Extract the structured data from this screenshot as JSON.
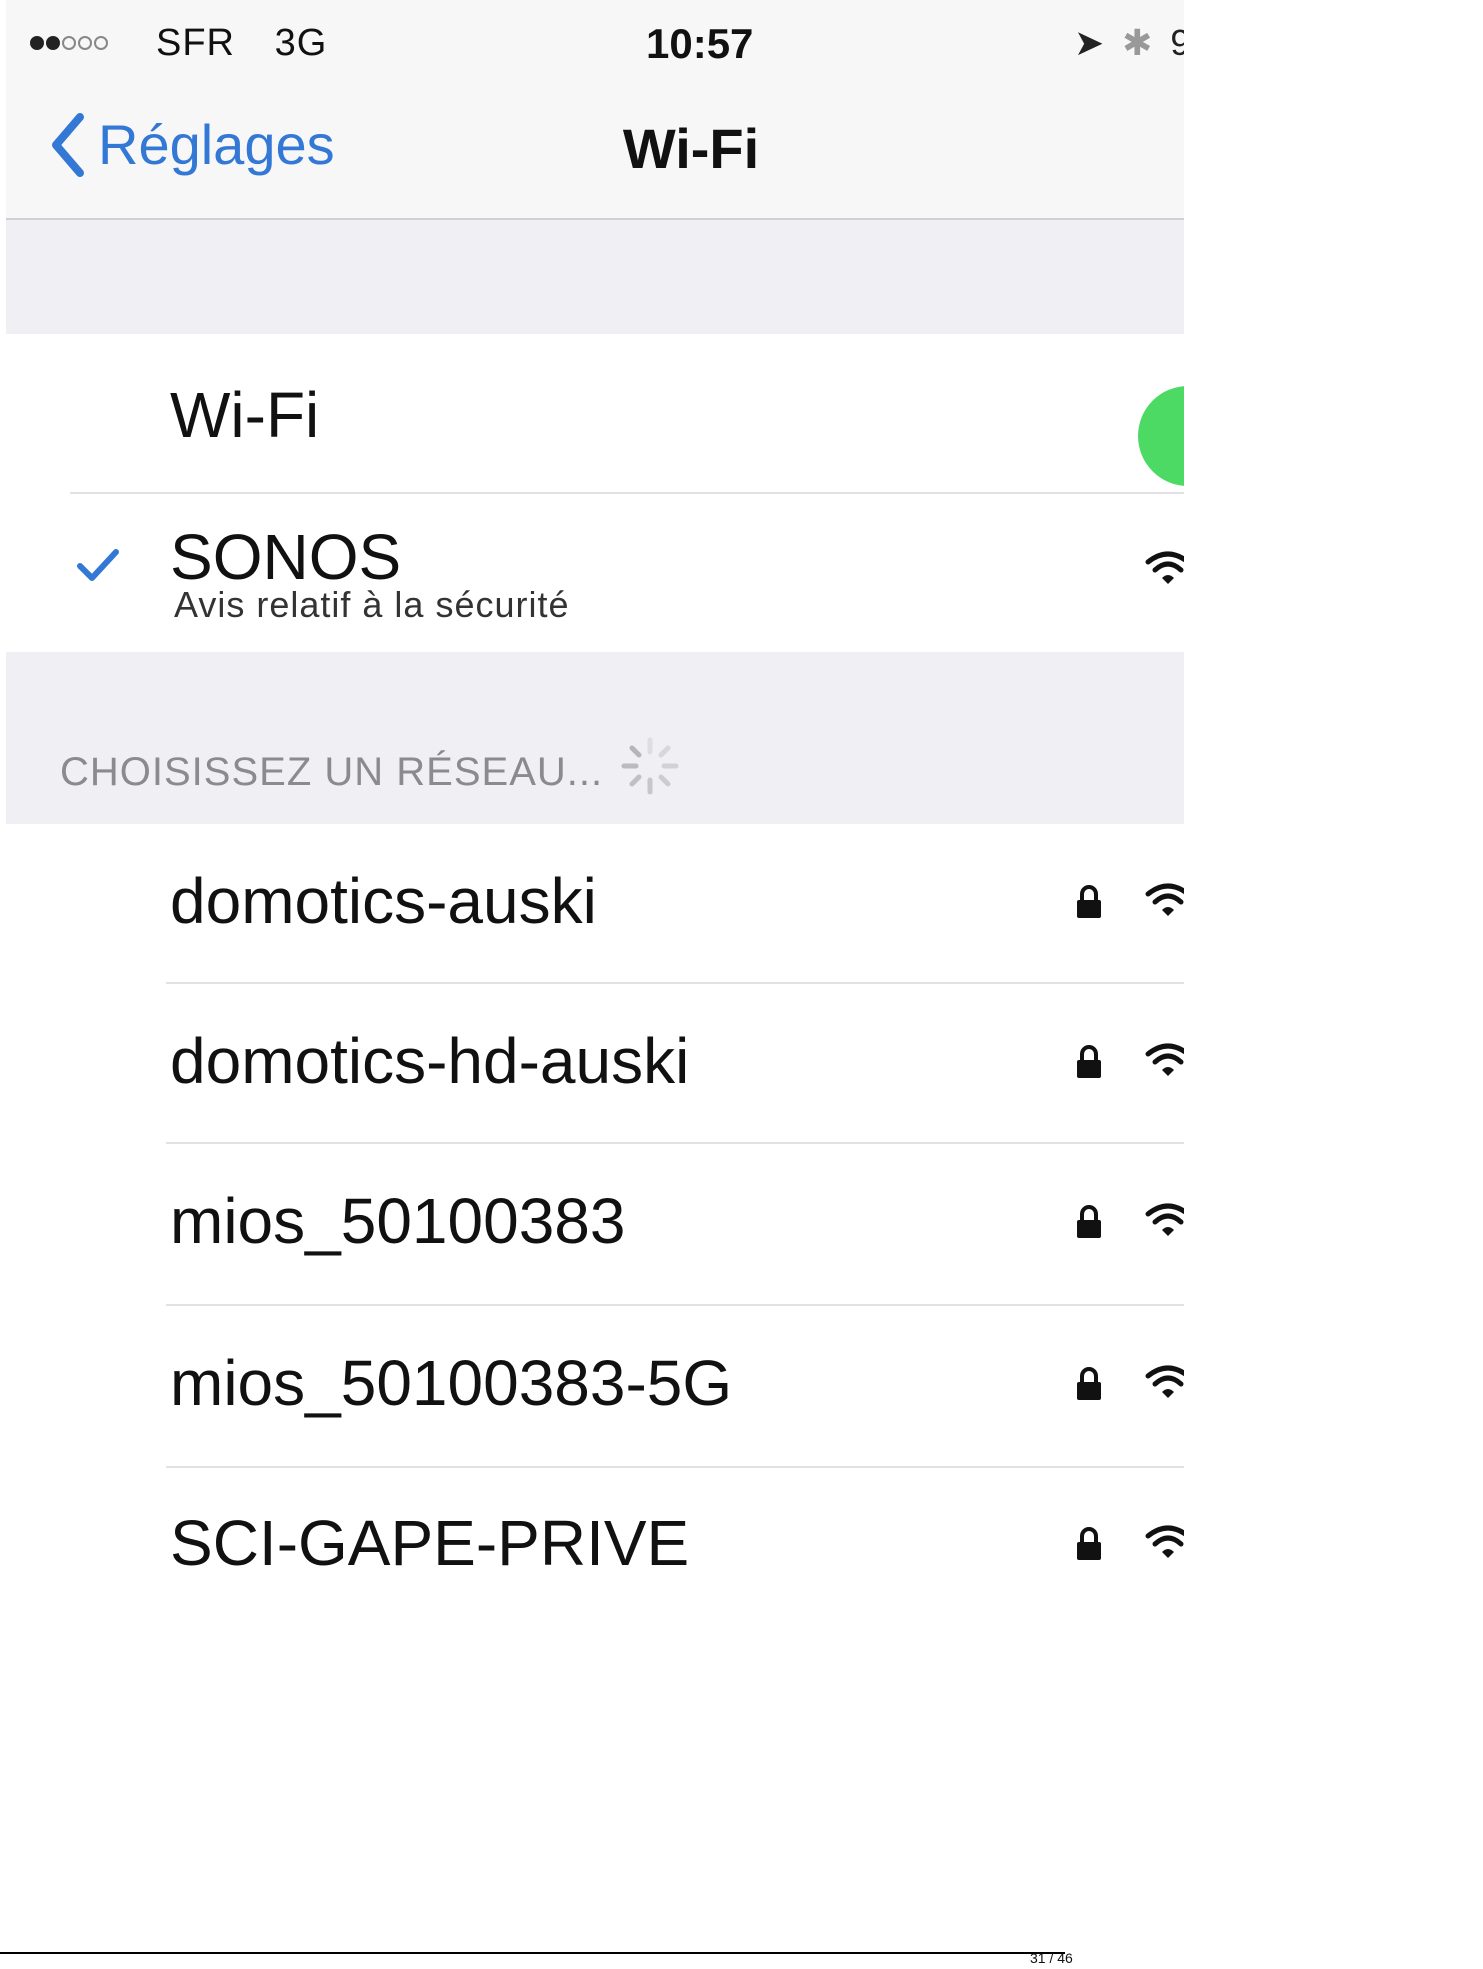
{
  "status_bar": {
    "carrier": "SFR",
    "network": "3G",
    "time": "10:57",
    "signal_bars_filled": 2,
    "signal_bars_total": 5,
    "battery_partial": "9"
  },
  "nav": {
    "back_label": "Réglages",
    "title": "Wi-Fi"
  },
  "wifi_toggle": {
    "label": "Wi-Fi",
    "enabled": true,
    "color": "#4cd964"
  },
  "connected_network": {
    "name": "SONOS",
    "subtitle": "Avis relatif à la sécurité",
    "check_color": "#3478d6"
  },
  "networks_section": {
    "header": "CHOISISSEZ UN RÉSEAU..."
  },
  "networks": [
    {
      "name": "domotics-auski",
      "locked": true
    },
    {
      "name": "domotics-hd-auski",
      "locked": true
    },
    {
      "name": "mios_50100383",
      "locked": true
    },
    {
      "name": "mios_50100383-5G",
      "locked": true
    },
    {
      "name": "SCI-GAPE-PRIVE",
      "locked": true
    }
  ],
  "footer": {
    "page_indicator": "31 / 46"
  },
  "colors": {
    "accent_blue": "#3478d6",
    "toggle_green": "#4cd964",
    "grouped_background": "#efeff4"
  }
}
